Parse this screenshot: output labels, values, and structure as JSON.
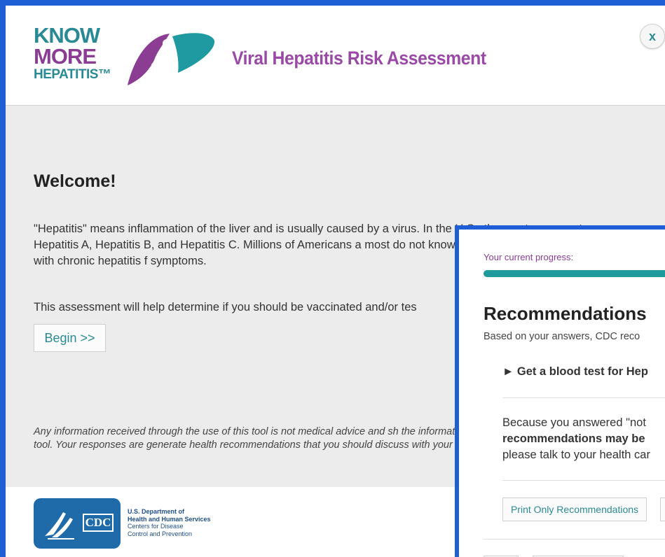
{
  "header": {
    "logo": {
      "line1": "KNOW",
      "line2": "MORE",
      "line3": "HEPATITIS™"
    },
    "app_title": "Viral Hepatitis Risk Assessment",
    "close_label": "x"
  },
  "main": {
    "welcome": "Welcome!",
    "intro": "\"Hepatitis\" means inflammation of the liver and is usually caused by a virus. In the U.S., the most common types are Hepatitis A, Hepatitis B, and Hepatitis C. Millions of Americans a most do not know they are infected. People can live with chronic hepatitis f symptoms.",
    "assessment": "This assessment will help determine if you should be vaccinated and/or tes",
    "begin_label": "Begin >>",
    "disclaimer": "Any information received through the use of this tool is not medical advice and sh the information you provide is stored or retained by this tool. Your responses are generate health recommendations that you should discuss with your doctor or yo"
  },
  "footer": {
    "cdc_label": "CDC",
    "hhs_line1": "U.S. Department of",
    "hhs_line2": "Health and Human Services",
    "hhs_line3": "Centers for Disease",
    "hhs_line4": "Control and Prevention"
  },
  "panel": {
    "progress_label": "Your current progress:",
    "progress_fraction": 0.9,
    "title": "Recommendations",
    "subtitle": "Based on your answers, CDC reco",
    "item": "► Get a blood test for Hep",
    "because_line1": "Because you answered \"not",
    "because_line2": "recommendations may be",
    "because_line3": "please talk to your health car",
    "print_label": "Print Only Recommendations"
  },
  "colors": {
    "frame_border": "#1f5fd6",
    "brand_teal": "#2a8a94",
    "brand_purple": "#8a3d93",
    "progress": "#1f9a9a"
  }
}
